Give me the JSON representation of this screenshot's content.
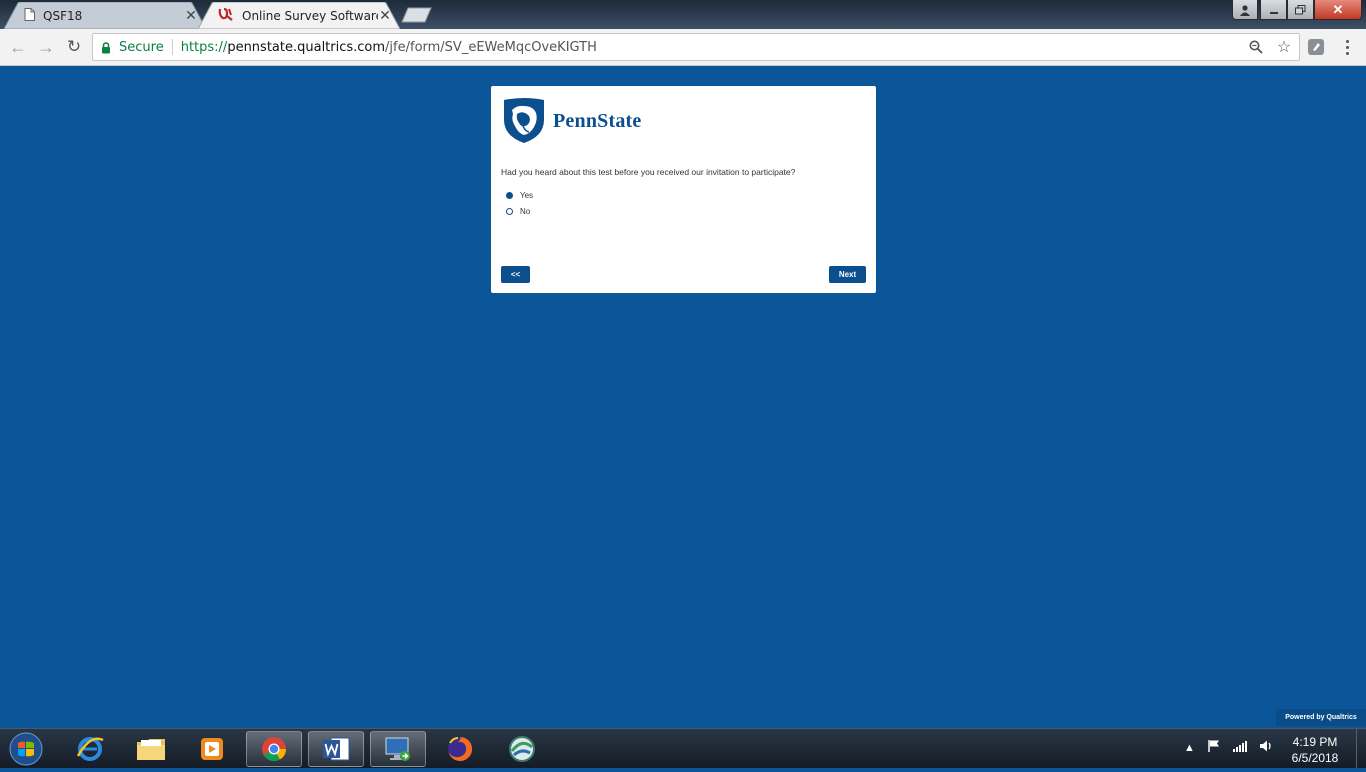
{
  "browser": {
    "tabs": [
      {
        "title": "QSF18",
        "icon": "document-icon"
      },
      {
        "title": "Online Survey Software | Q",
        "icon": "qualtrics-icon"
      }
    ],
    "address": {
      "secure_label": "Secure",
      "url_protocol": "https://",
      "url_host": "pennstate.qualtrics.com",
      "url_path": "/jfe/form/SV_eEWeMqcOveKIGTH"
    }
  },
  "survey": {
    "logo_text": "PennState",
    "question": "Had you heard about this test before you received our invitation to participate?",
    "choices": [
      {
        "label": "Yes",
        "selected": true
      },
      {
        "label": "No",
        "selected": false
      }
    ],
    "back_label": "<<",
    "next_label": "Next",
    "powered_by": "Powered by Qualtrics"
  },
  "taskbar": {
    "time": "4:19 PM",
    "date": "6/5/2018"
  },
  "colors": {
    "page_bg": "#0b5599",
    "brand": "#0b4f8f",
    "secure_green": "#0b8043"
  }
}
